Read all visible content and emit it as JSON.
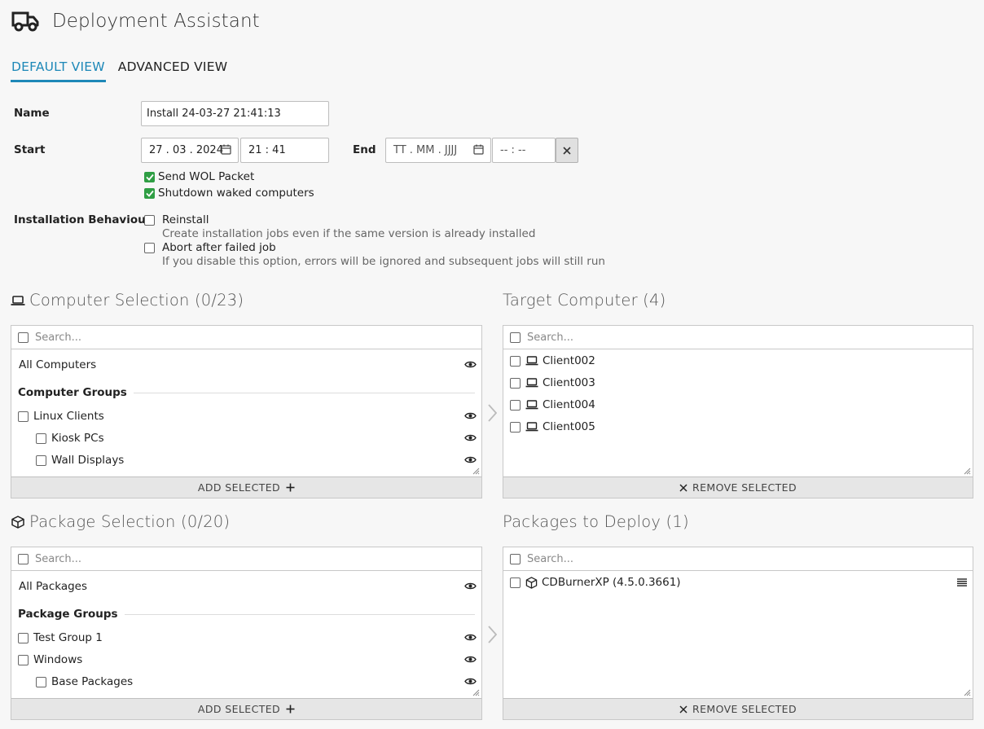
{
  "app": {
    "title": "Deployment Assistant"
  },
  "tabs": [
    {
      "label": "DEFAULT VIEW",
      "active": true
    },
    {
      "label": "ADVANCED VIEW",
      "active": false
    }
  ],
  "form": {
    "name_label": "Name",
    "name_value": "Install 24-03-27 21:41:13",
    "start_label": "Start",
    "start_date": "27 . 03 . 2024",
    "start_time": "21 : 41",
    "end_label": "End",
    "end_date_placeholder": "TT . MM . JJJJ",
    "end_time_placeholder": "-- : --",
    "send_wol_label": "Send WOL Packet",
    "send_wol_checked": true,
    "shutdown_label": "Shutdown waked computers",
    "shutdown_checked": true,
    "behaviour_label": "Installation Behaviour",
    "reinstall_label": "Reinstall",
    "reinstall_desc": "Create installation jobs even if the same version is already installed",
    "abort_label": "Abort after failed job",
    "abort_desc": "If you disable this option, errors will be ignored and subsequent jobs will still run"
  },
  "computer_selection": {
    "title": "Computer Selection (0/23)",
    "search_placeholder": "Search...",
    "all_label": "All Computers",
    "groups_heading": "Computer Groups",
    "groups": [
      {
        "label": "Linux Clients",
        "level": 0
      },
      {
        "label": "Kiosk PCs",
        "level": 1
      },
      {
        "label": "Wall Displays",
        "level": 1
      }
    ],
    "action_label": "ADD SELECTED"
  },
  "target_computers": {
    "title": "Target Computer (4)",
    "search_placeholder": "Search...",
    "items": [
      "Client002",
      "Client003",
      "Client004",
      "Client005"
    ],
    "action_label": "REMOVE SELECTED"
  },
  "package_selection": {
    "title": "Package Selection (0/20)",
    "search_placeholder": "Search...",
    "all_label": "All Packages",
    "groups_heading": "Package Groups",
    "groups": [
      {
        "label": "Test Group 1",
        "level": 0
      },
      {
        "label": "Windows",
        "level": 0
      },
      {
        "label": "Base Packages",
        "level": 1
      }
    ],
    "action_label": "ADD SELECTED"
  },
  "packages_to_deploy": {
    "title": "Packages to Deploy (1)",
    "search_placeholder": "Search...",
    "items": [
      "CDBurnerXP (4.5.0.3661)"
    ],
    "action_label": "REMOVE SELECTED"
  },
  "colors": {
    "accent": "#1e88b8",
    "check_green": "#2f9e44"
  },
  "icons": {
    "title": "truck-icon",
    "calendar": "calendar-icon",
    "clear": "close-icon",
    "computer": "laptop-icon",
    "package": "package-icon",
    "eye": "eye-icon",
    "plus": "plus-icon",
    "handle": "drag-handle-icon",
    "arrow": "chevron-right-icon"
  }
}
